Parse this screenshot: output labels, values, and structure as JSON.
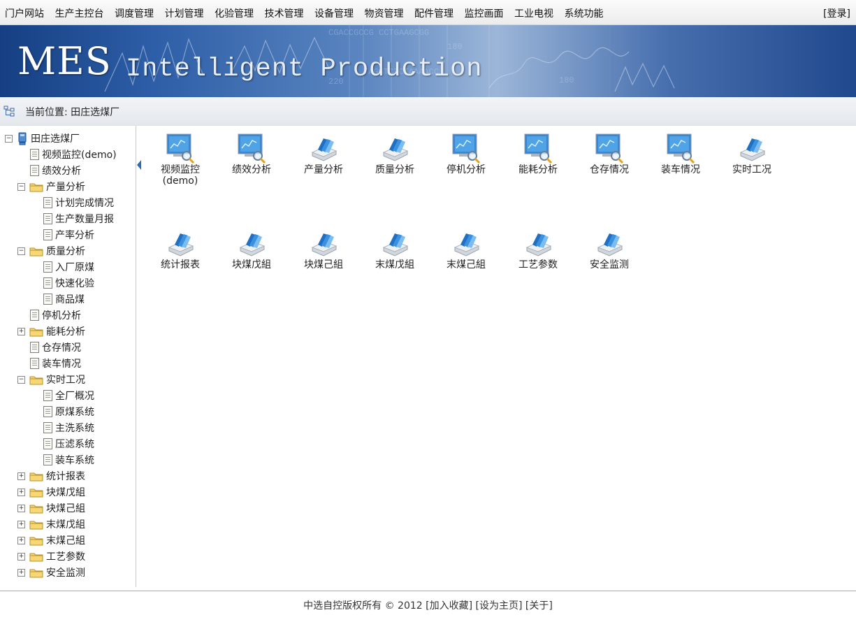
{
  "topnav": {
    "items": [
      "门户网站",
      "生产主控台",
      "调度管理",
      "计划管理",
      "化验管理",
      "技术管理",
      "设备管理",
      "物资管理",
      "配件管理",
      "监控画面",
      "工业电视",
      "系统功能"
    ],
    "login": "[登录]"
  },
  "banner": {
    "title": "MES",
    "subtitle": "Intelligent Production"
  },
  "breadcrumb": {
    "text": "当前位置: 田庄选煤厂"
  },
  "tree": {
    "root": "田庄选煤厂",
    "nodes": [
      {
        "label": "视频监控(demo)",
        "type": "leaf",
        "indent": 1
      },
      {
        "label": "绩效分析",
        "type": "leaf",
        "indent": 1
      },
      {
        "label": "产量分析",
        "type": "folder",
        "indent": 1,
        "state": "expanded"
      },
      {
        "label": "计划完成情况",
        "type": "leaf",
        "indent": 2
      },
      {
        "label": "生产数量月报",
        "type": "leaf",
        "indent": 2
      },
      {
        "label": "产率分析",
        "type": "leaf",
        "indent": 2
      },
      {
        "label": "质量分析",
        "type": "folder",
        "indent": 1,
        "state": "expanded"
      },
      {
        "label": "入厂原煤",
        "type": "leaf",
        "indent": 2
      },
      {
        "label": "快速化验",
        "type": "leaf",
        "indent": 2
      },
      {
        "label": "商品煤",
        "type": "leaf",
        "indent": 2
      },
      {
        "label": "停机分析",
        "type": "leaf",
        "indent": 1
      },
      {
        "label": "能耗分析",
        "type": "folder",
        "indent": 1,
        "state": "collapsed"
      },
      {
        "label": "仓存情况",
        "type": "leaf",
        "indent": 1
      },
      {
        "label": "装车情况",
        "type": "leaf",
        "indent": 1
      },
      {
        "label": "实时工况",
        "type": "folder",
        "indent": 1,
        "state": "expanded"
      },
      {
        "label": "全厂概况",
        "type": "leaf",
        "indent": 2
      },
      {
        "label": "原煤系统",
        "type": "leaf",
        "indent": 2
      },
      {
        "label": "主洗系统",
        "type": "leaf",
        "indent": 2
      },
      {
        "label": "压滤系统",
        "type": "leaf",
        "indent": 2
      },
      {
        "label": "装车系统",
        "type": "leaf",
        "indent": 2
      },
      {
        "label": "统计报表",
        "type": "folder",
        "indent": 1,
        "state": "collapsed"
      },
      {
        "label": "块煤戊組",
        "type": "folder",
        "indent": 1,
        "state": "collapsed"
      },
      {
        "label": "块煤己組",
        "type": "folder",
        "indent": 1,
        "state": "collapsed"
      },
      {
        "label": "末煤戊組",
        "type": "folder",
        "indent": 1,
        "state": "collapsed"
      },
      {
        "label": "末煤己組",
        "type": "folder",
        "indent": 1,
        "state": "collapsed"
      },
      {
        "label": "工艺参数",
        "type": "folder",
        "indent": 1,
        "state": "collapsed"
      },
      {
        "label": "安全监测",
        "type": "folder",
        "indent": 1,
        "state": "collapsed"
      }
    ]
  },
  "tiles": [
    {
      "label": "视频监控\n(demo)",
      "icon": "monitor-magnifier-icon"
    },
    {
      "label": "绩效分析",
      "icon": "monitor-magnifier-icon"
    },
    {
      "label": "产量分析",
      "icon": "document-stack-icon"
    },
    {
      "label": "质量分析",
      "icon": "document-stack-icon"
    },
    {
      "label": "停机分析",
      "icon": "monitor-magnifier-icon"
    },
    {
      "label": "能耗分析",
      "icon": "monitor-magnifier-icon"
    },
    {
      "label": "仓存情况",
      "icon": "monitor-magnifier-icon"
    },
    {
      "label": "装车情况",
      "icon": "monitor-magnifier-icon"
    },
    {
      "label": "实时工况",
      "icon": "document-stack-icon"
    },
    {
      "label": "统计报表",
      "icon": "document-stack-icon"
    },
    {
      "label": "块煤戊組",
      "icon": "document-stack-icon"
    },
    {
      "label": "块煤己組",
      "icon": "document-stack-icon"
    },
    {
      "label": "末煤戊組",
      "icon": "document-stack-icon"
    },
    {
      "label": "末煤己組",
      "icon": "document-stack-icon"
    },
    {
      "label": "工艺参数",
      "icon": "document-stack-icon"
    },
    {
      "label": "安全监测",
      "icon": "document-stack-icon"
    }
  ],
  "footer": {
    "copyright": "中选自控版权所有 © 2012",
    "links": [
      "[加入收藏]",
      "[设为主页]",
      "[关于]"
    ]
  },
  "colors": {
    "accent": "#2a6fbf",
    "banner_dark": "#163f83",
    "folder": "#f2c94c"
  }
}
